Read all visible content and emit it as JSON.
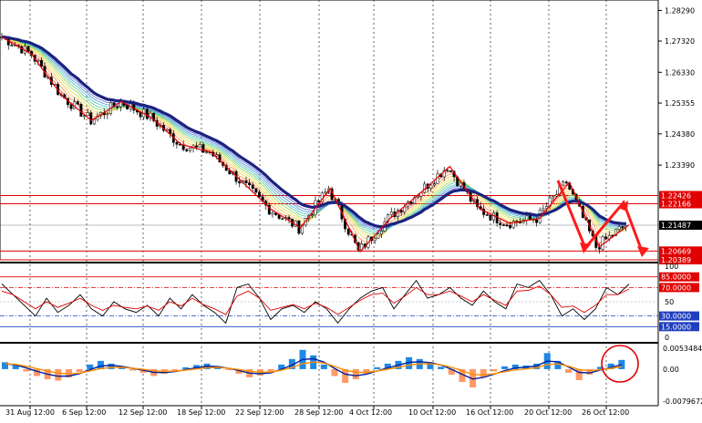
{
  "chart_data": [
    {
      "type": "candlestick",
      "title": "",
      "price_ticks": [
        "1.28290",
        "1.27320",
        "1.26330",
        "1.25355",
        "1.24380",
        "1.23390"
      ],
      "horizontal_levels": [
        {
          "label": "1.22426",
          "value": 1.22426,
          "color": "#e00000"
        },
        {
          "label": "1.22166",
          "value": 1.22166,
          "color": "#e00000"
        },
        {
          "label": "1.21487",
          "value": 1.21487,
          "color": "#000000"
        },
        {
          "label": "1.20669",
          "value": 1.20669,
          "color": "#e00000"
        },
        {
          "label": "1.20389",
          "value": 1.20389,
          "color": "#e00000"
        }
      ],
      "ylim": [
        1.2039,
        1.2862
      ],
      "close_path": [
        [
          "31 Aug 12:00",
          1.2745
        ],
        [
          "31 Aug 12:00",
          1.269
        ],
        [
          "6 Sep 12:00",
          1.256
        ],
        [
          "6 Sep 12:00",
          1.248
        ],
        [
          "12 Sep 12:00",
          1.254
        ],
        [
          "12 Sep 12:00",
          1.249
        ],
        [
          "18 Sep 12:00",
          1.2405
        ],
        [
          "18 Sep 12:00",
          1.238
        ],
        [
          "22 Sep 12:00",
          1.229
        ],
        [
          "22 Sep 12:00",
          1.22
        ],
        [
          "28 Sep 12:00",
          1.214
        ],
        [
          "28 Sep 12:00",
          1.2265
        ],
        [
          "4 Oct 12:00",
          1.2065
        ],
        [
          "4 Oct 12:00",
          1.217
        ],
        [
          "10 Oct 12:00",
          1.225
        ],
        [
          "10 Oct 12:00",
          1.2335
        ],
        [
          "16 Oct 12:00",
          1.22
        ],
        [
          "16 Oct 12:00",
          1.2155
        ],
        [
          "20 Oct 12:00",
          1.217
        ],
        [
          "20 Oct 12:00",
          1.2285
        ],
        [
          "26 Oct 12:00",
          1.208
        ],
        [
          "26 Oct 12:00",
          1.215
        ]
      ],
      "zigzag_color": "#e00000",
      "ma_color": "#1a237e"
    },
    {
      "type": "line",
      "title": "",
      "ylim": [
        0,
        100
      ],
      "ticks": [
        "100",
        "50",
        "0"
      ],
      "levels": [
        {
          "label": "85.0000",
          "value": 85,
          "color": "#e00000"
        },
        {
          "label": "70.0000",
          "value": 70,
          "color": "#e00000"
        },
        {
          "label": "30.0000",
          "value": 30,
          "color": "#1f3fbf"
        },
        {
          "label": "15.0000",
          "value": 15,
          "color": "#1f3fbf"
        }
      ],
      "series": [
        {
          "color": "#000000",
          "values": [
            75,
            60,
            45,
            30,
            55,
            35,
            45,
            60,
            40,
            30,
            50,
            40,
            35,
            45,
            30,
            55,
            40,
            60,
            45,
            35,
            20,
            70,
            75,
            55,
            25,
            40,
            45,
            35,
            50,
            40,
            20,
            40,
            55,
            65,
            70,
            40,
            60,
            80,
            55,
            60,
            70,
            55,
            45,
            65,
            50,
            40,
            75,
            70,
            80,
            60,
            30,
            40,
            25,
            40,
            70,
            60,
            75
          ]
        },
        {
          "color": "#e00000",
          "values": [
            65,
            60,
            50,
            40,
            50,
            42,
            48,
            55,
            45,
            38,
            45,
            42,
            40,
            44,
            38,
            50,
            44,
            55,
            46,
            40,
            32,
            58,
            65,
            55,
            38,
            42,
            46,
            40,
            48,
            42,
            32,
            42,
            52,
            60,
            62,
            48,
            58,
            70,
            60,
            60,
            65,
            58,
            50,
            60,
            52,
            45,
            65,
            66,
            72,
            60,
            42,
            44,
            35,
            45,
            60,
            60,
            68
          ]
        }
      ]
    },
    {
      "type": "bar",
      "title": "",
      "ticks": [
        "0.0053484",
        "0.00",
        "-0.0079672"
      ],
      "ylim": [
        -0.0079672,
        0.0053484
      ],
      "positive_color": "#1e88e5",
      "negative_color": "#ff9966",
      "signal_color": "#ff8c00",
      "main_color": "#001f9f",
      "values": [
        0.0015,
        0.0008,
        -0.0005,
        -0.0015,
        -0.0022,
        -0.0025,
        -0.0018,
        -0.0006,
        0.001,
        0.0018,
        0.0012,
        0.0005,
        -0.0003,
        -0.0008,
        -0.0015,
        -0.001,
        -0.0004,
        0.0004,
        0.0009,
        0.0012,
        0.0006,
        -0.0002,
        -0.001,
        -0.0018,
        -0.0014,
        -0.0008,
        0.001,
        0.0022,
        0.0042,
        0.003,
        0.001,
        -0.0015,
        -0.003,
        -0.0022,
        -0.001,
        0.0004,
        0.0012,
        0.0018,
        0.0026,
        0.0022,
        0.0015,
        0.0005,
        -0.0012,
        -0.0028,
        -0.004,
        -0.0018,
        -0.0005,
        0.0006,
        0.001,
        0.0008,
        0.0012,
        0.0035,
        0.0018,
        -0.0008,
        -0.0024,
        -0.0012,
        0.0005,
        0.0012,
        0.002
      ],
      "annotation": {
        "shape": "circle",
        "color": "#e00000"
      }
    }
  ],
  "time_axis": [
    "31 Aug 12:00",
    "6 Sep 12:00",
    "12 Sep 12:00",
    "18 Sep 12:00",
    "22 Sep 12:00",
    "28 Sep 12:00",
    "4 Oct 12:00",
    "10 Oct 12:00",
    "16 Oct 12:00",
    "20 Oct 12:00",
    "26 Oct 12:00"
  ]
}
